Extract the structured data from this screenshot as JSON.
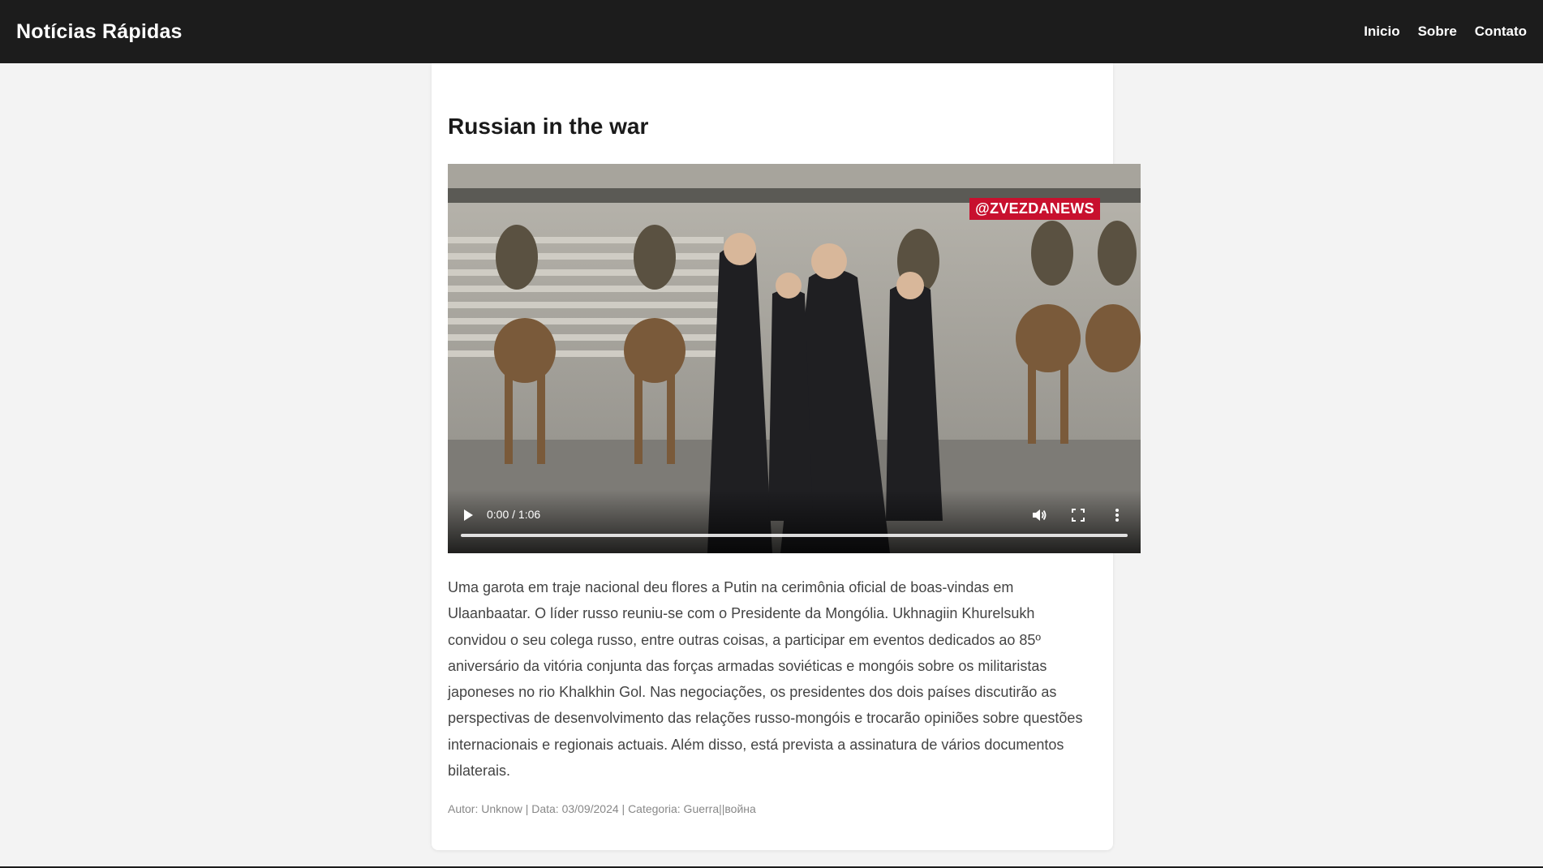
{
  "header": {
    "brand": "Notícias Rápidas",
    "nav": [
      "Inicio",
      "Sobre",
      "Contato"
    ]
  },
  "article": {
    "title": "Russian in the war",
    "body": "Uma garota em traje nacional deu flores a Putin na cerimônia oficial de boas-vindas em Ulaanbaatar. O líder russo reuniu-se com o Presidente da Mongólia. Ukhnagiin Khurelsukh convidou o seu colega russo, entre outras coisas, a participar em eventos dedicados ao 85º aniversário da vitória conjunta das forças armadas soviéticas e mongóis sobre os militaristas japoneses no rio Khalkhin Gol. Nas negociações, os presidentes dos dois países discutirão as perspectivas de desenvolvimento das relações russo-mongóis e trocarão opiniões sobre questões internacionais e regionais actuais. Além disso, está prevista a assinatura de vários documentos bilaterais.",
    "meta": "Autor: Unknow | Data: 03/09/2024 | Categoria: Guerra||война"
  },
  "video": {
    "watermark": "@ZVEZDANEWS",
    "time": "0:00 / 1:06",
    "progress": 0,
    "icons": [
      "play-icon",
      "volume-icon",
      "fullscreen-icon",
      "more-options-icon"
    ]
  },
  "colors": {
    "header_bg": "#1c1c1c",
    "page_bg": "#f3f3f3",
    "watermark_bg": "#c8102e"
  }
}
